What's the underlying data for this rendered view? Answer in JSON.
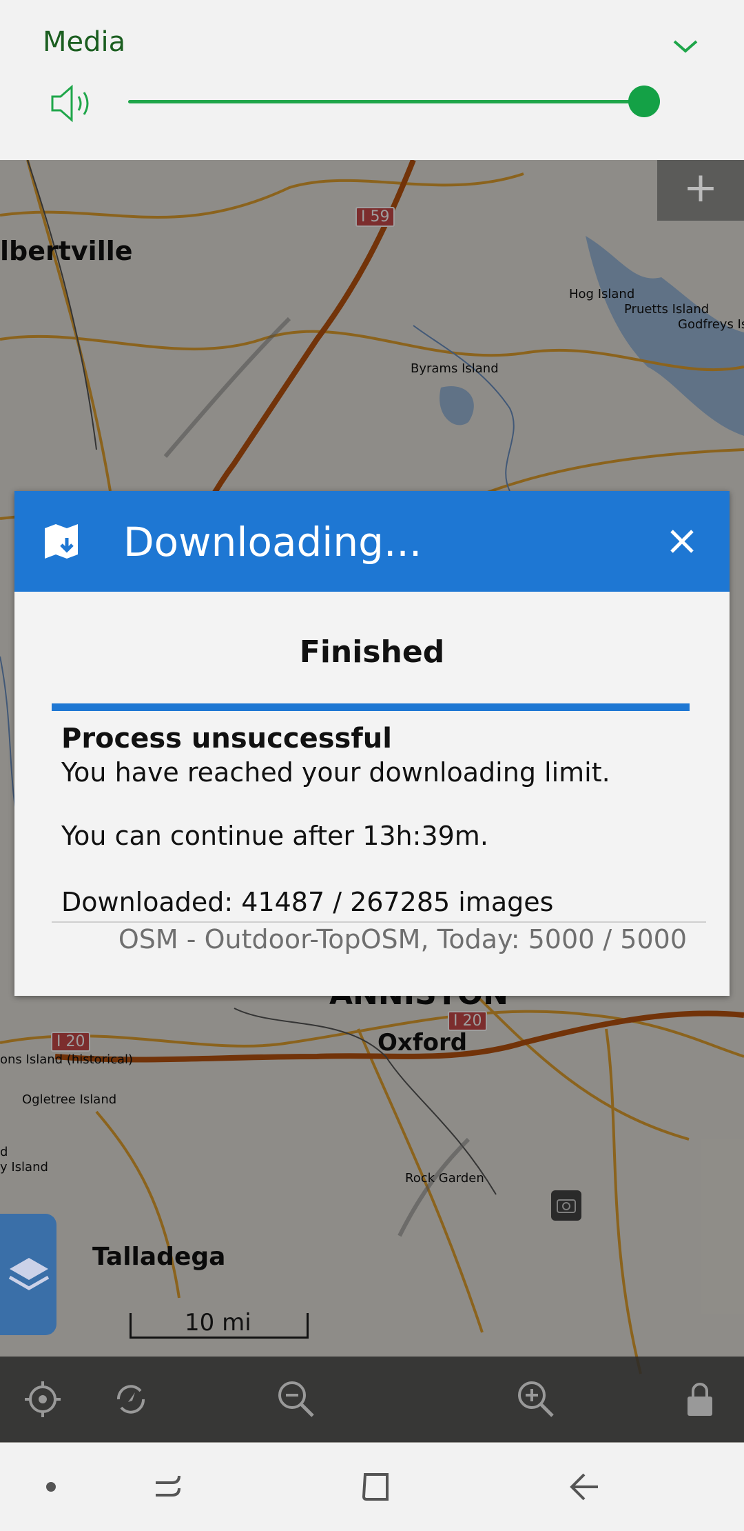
{
  "volume": {
    "title": "Media",
    "level_percent": 100,
    "accent_color": "#1fa64a",
    "icons": {
      "speaker": "speaker-icon",
      "collapse": "chevron-down-icon"
    }
  },
  "map": {
    "labels": {
      "albertville": "lbertville",
      "hog_island": "Hog Island",
      "pruetts_island": "Pruetts Island",
      "godfreys_island": "Godfreys Is",
      "byrams_island": "Byrams Island",
      "anniston": "ANNISTON",
      "oxford": "Oxford",
      "historical_island": "ons Island (historical)",
      "ogletree_island": "Ogletree Island",
      "island_d": "d",
      "island_y": "y Island",
      "rock_garden": "Rock Garden",
      "talladega": "Talladega"
    },
    "shields": {
      "i59": "I 59",
      "i20_left": "I 20",
      "i20_right": "I 20"
    },
    "scale": "10 mi",
    "zoom_in_top": "+"
  },
  "toolbar": {
    "icons": [
      "my-location-icon",
      "rotate-icon",
      "zoom-out-icon",
      "zoom-in-icon",
      "lock-icon"
    ]
  },
  "dialog": {
    "title": "Downloading...",
    "header_color": "#1e77d3",
    "status": "Finished",
    "progress_fraction": 1.0,
    "result_title": "Process unsuccessful",
    "result_message": "You have reached your downloading limit.",
    "continue_message": "You can continue after 13h:39m.",
    "downloaded": "Downloaded: 41487 / 267285 images",
    "source_limit": "OSM - Outdoor-TopOSM, Today: 5000 / 5000"
  },
  "nav": {
    "icons": [
      "dot-icon",
      "recents-icon",
      "home-icon",
      "back-icon"
    ]
  }
}
